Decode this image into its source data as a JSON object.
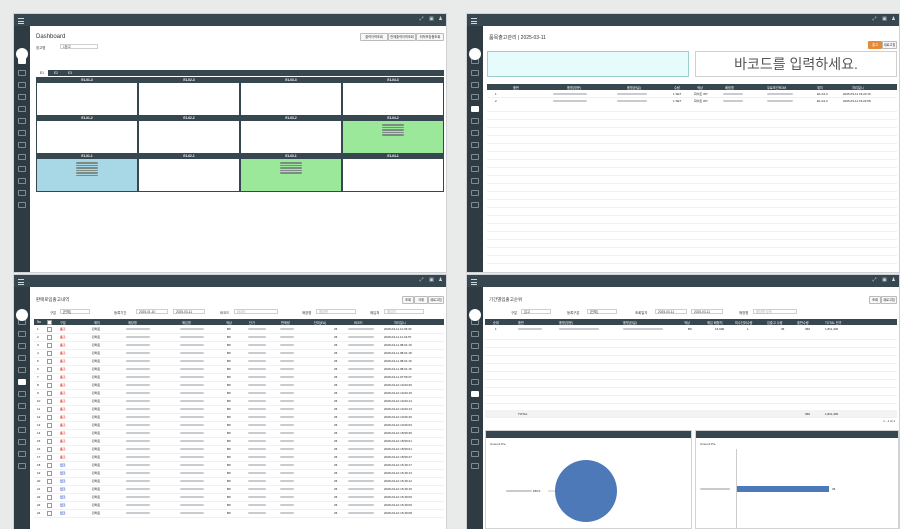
{
  "dashboard": {
    "title": "Dashboard",
    "filter_label": "창고명",
    "filter_value": "1창고",
    "buttons": [
      "출력이력조회",
      "판매출력이력조회",
      "최적포장품조회"
    ],
    "tabs": [
      "E1",
      "E2",
      "E3"
    ],
    "cells": [
      {
        "label": "E1-01-3",
        "state": "empty"
      },
      {
        "label": "E1-02-3",
        "state": "empty"
      },
      {
        "label": "E1-03-3",
        "state": "empty"
      },
      {
        "label": "E1-04-3",
        "state": "empty"
      },
      {
        "label": "E1-01-2",
        "state": "empty"
      },
      {
        "label": "E1-02-2",
        "state": "empty"
      },
      {
        "label": "E1-03-2",
        "state": "empty"
      },
      {
        "label": "E1-04-2",
        "state": "green"
      },
      {
        "label": "E1-01-1",
        "state": "blue"
      },
      {
        "label": "E1-02-1",
        "state": "empty"
      },
      {
        "label": "E1-03-1",
        "state": "green"
      },
      {
        "label": "E1-04-1",
        "state": "empty"
      }
    ]
  },
  "scan": {
    "title": "품목출고관리 | 2025-03-11",
    "btn_search": "출고",
    "btn_new": "새로고침",
    "placeholder": "바코드를 입력하세요.",
    "columns": [
      "품번",
      "품명(영문)",
      "품명(한글)",
      "수량",
      "색상",
      "배정명",
      "무료조건ROM",
      "위치",
      "처리일시"
    ],
    "rows": [
      {
        "no": "1",
        "qty": "1 SET",
        "color": "화이트 WT",
        "loc": "E1-04-3",
        "time": "2025-03-11 15:23:16"
      },
      {
        "no": "2",
        "qty": "1 SET",
        "color": "화이트 WT",
        "loc": "E1-04-3",
        "time": "2025-03-11 15:22:58"
      }
    ]
  },
  "history": {
    "title": "판매로입출고내역",
    "labels": {
      "type": "구분",
      "period": "등록기간",
      "barcode": "바코드",
      "shop": "매장명",
      "supplier": "매입처"
    },
    "type_value": "[전체]",
    "date_from": "2025-01-10",
    "date_to": "2025-03-11",
    "barcode_ph": "바코드",
    "shop_ph": "매장명",
    "supplier_ph": "매입처",
    "buttons": [
      "조회",
      "삭제",
      "새로고침"
    ],
    "columns": [
      "No",
      "",
      "구분",
      "매처",
      "매장명",
      "매입명",
      "색상",
      "단가",
      "판매량",
      "단위(EA)",
      "바코드",
      "처리일시"
    ],
    "rows": [
      {
        "no": "1",
        "type": "출고",
        "cls": "red",
        "shop": "판매로",
        "color": "BK",
        "qty": "25",
        "time": "2025-03-11 11:45:33"
      },
      {
        "no": "2",
        "type": "출고",
        "cls": "red",
        "shop": "판매로",
        "color": "BK",
        "qty": "25",
        "time": "2025-03-11 11:44:57"
      },
      {
        "no": "3",
        "type": "출고",
        "cls": "red",
        "shop": "판매로",
        "color": "BK",
        "qty": "25",
        "time": "2025-03-11 08:01:19"
      },
      {
        "no": "4",
        "type": "출고",
        "cls": "red",
        "shop": "판매로",
        "color": "BK",
        "qty": "25",
        "time": "2025-03-11 08:01:18"
      },
      {
        "no": "5",
        "type": "출고",
        "cls": "red",
        "shop": "판매로",
        "color": "BK",
        "qty": "25",
        "time": "2025-03-11 08:01:16"
      },
      {
        "no": "6",
        "type": "출고",
        "cls": "red",
        "shop": "판매로",
        "color": "BK",
        "qty": "25",
        "time": "2025-03-11 08:01:15"
      },
      {
        "no": "7",
        "type": "출고",
        "cls": "red",
        "shop": "판매로",
        "color": "BK",
        "qty": "25",
        "time": "2025-03-11 07:59:37"
      },
      {
        "no": "8",
        "type": "출고",
        "cls": "red",
        "shop": "판매로",
        "color": "BK",
        "qty": "25",
        "time": "2025-03-10 19:00:26"
      },
      {
        "no": "9",
        "type": "출고",
        "cls": "red",
        "shop": "판매로",
        "color": "BK",
        "qty": "25",
        "time": "2025-03-10 19:00:15"
      },
      {
        "no": "10",
        "type": "출고",
        "cls": "red",
        "shop": "판매로",
        "color": "BK",
        "qty": "25",
        "time": "2025-03-10 19:00:14"
      },
      {
        "no": "11",
        "type": "출고",
        "cls": "red",
        "shop": "판매로",
        "color": "BK",
        "qty": "25",
        "time": "2025-03-10 19:00:13"
      },
      {
        "no": "12",
        "type": "출고",
        "cls": "red",
        "shop": "판매로",
        "color": "BK",
        "qty": "25",
        "time": "2025-03-10 19:06:46"
      },
      {
        "no": "13",
        "type": "출고",
        "cls": "red",
        "shop": "판매로",
        "color": "BK",
        "qty": "25",
        "time": "2025-03-10 19:06:03"
      },
      {
        "no": "14",
        "type": "출고",
        "cls": "red",
        "shop": "판매로",
        "color": "BK",
        "qty": "25",
        "time": "2025-03-10 18:59:36"
      },
      {
        "no": "15",
        "type": "출고",
        "cls": "red",
        "shop": "판매로",
        "color": "BK",
        "qty": "25",
        "time": "2025-03-10 18:59:01"
      },
      {
        "no": "16",
        "type": "출고",
        "cls": "red",
        "shop": "판매로",
        "color": "BK",
        "qty": "25",
        "time": "2025-03-10 18:59:01"
      },
      {
        "no": "17",
        "type": "출고",
        "cls": "red",
        "shop": "판매로",
        "color": "BK",
        "qty": "25",
        "time": "2025-03-10 18:59:47"
      },
      {
        "no": "18",
        "type": "입고",
        "cls": "blue2",
        "shop": "판매로",
        "color": "BK",
        "qty": "25",
        "time": "2025-03-10 15:49:17"
      },
      {
        "no": "19",
        "type": "입고",
        "cls": "blue2",
        "shop": "판매로",
        "color": "BK",
        "qty": "25",
        "time": "2025-03-10 15:49:13"
      },
      {
        "no": "20",
        "type": "입고",
        "cls": "blue2",
        "shop": "판매로",
        "color": "BK",
        "qty": "25",
        "time": "2025-03-10 15:49:12"
      },
      {
        "no": "21",
        "type": "입고",
        "cls": "blue2",
        "shop": "판매로",
        "color": "BK",
        "qty": "25",
        "time": "2025-03-10 15:49:16"
      },
      {
        "no": "22",
        "type": "입고",
        "cls": "blue2",
        "shop": "판매로",
        "color": "BK",
        "qty": "25",
        "time": "2025-03-10 15:49:09"
      },
      {
        "no": "23",
        "type": "입고",
        "cls": "blue2",
        "shop": "판매로",
        "color": "BK",
        "qty": "25",
        "time": "2025-03-10 15:49:09"
      },
      {
        "no": "24",
        "type": "입고",
        "cls": "blue2",
        "shop": "판매로",
        "color": "BK",
        "qty": "25",
        "time": "2025-03-10 15:49:08"
      }
    ]
  },
  "period": {
    "title": "기간별입출고순위",
    "labels": {
      "type": "구분",
      "period": "등록구분",
      "dates": "조회일자",
      "shop": "매장명"
    },
    "type_value": "입고",
    "period_value": "[전체]",
    "date_from": "2025-03-11",
    "date_to": "2025-03-11",
    "shop_ph": "매장명 검색",
    "buttons": [
      "조회",
      "새로고침"
    ],
    "columns": [
      "순위",
      "품번",
      "품명(영문)",
      "품명(한글)",
      "색상",
      "매입 폐형처",
      "미수단위수량",
      "입출고 수량",
      "출판수량",
      "TOTAL 단가"
    ],
    "row": {
      "rank": "1",
      "color": "BK",
      "v1": "16,990",
      "v2": "1",
      "v3": "36",
      "v4": "360",
      "v5": "1,811,400"
    },
    "total": {
      "label": "TOTAL",
      "v4": "360",
      "v5": "1,811,400"
    },
    "pager": "1 - 1 of 1",
    "pie_title": "Amount Pie",
    "bar_title": "Amount Pie",
    "pie_label": "180.0",
    "bar_label": "36"
  },
  "chart_data": [
    {
      "type": "pie",
      "values": [
        100
      ],
      "title": "Amount Pie"
    },
    {
      "type": "bar",
      "values": [
        36
      ],
      "title": "Amount Pie"
    }
  ]
}
